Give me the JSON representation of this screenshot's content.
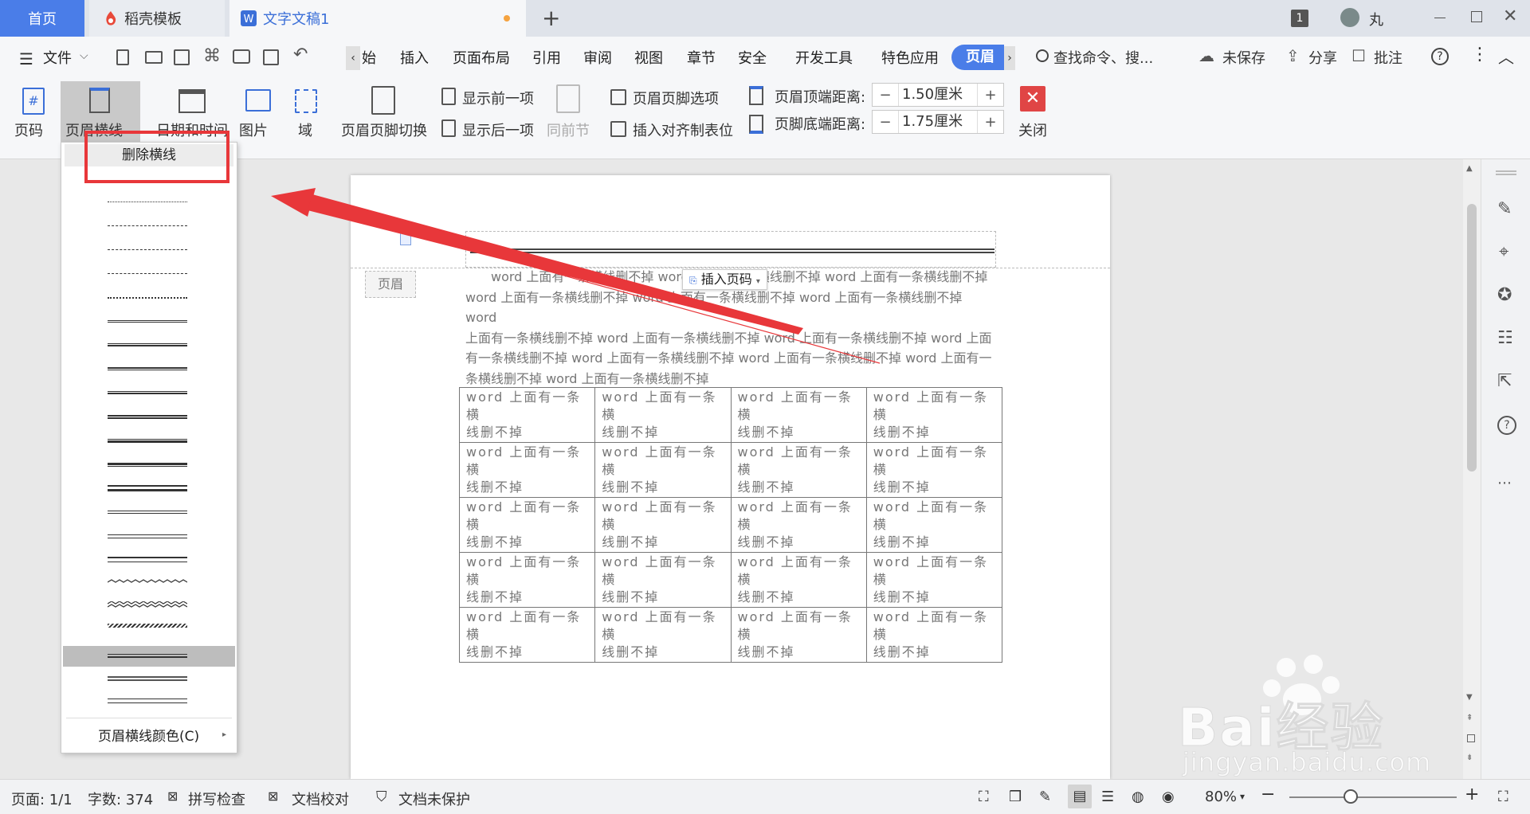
{
  "tabs": {
    "home": "首页",
    "template": "稻壳模板",
    "doc": "文字文稿1",
    "badge": "1",
    "user": "丸"
  },
  "menu": {
    "file": "文件",
    "items": [
      "始",
      "插入",
      "页面布局",
      "引用",
      "审阅",
      "视图",
      "章节",
      "安全",
      "开发工具",
      "特色应用"
    ],
    "active": "页眉",
    "search": "查找命令、搜...",
    "unsaved": "未保存",
    "share": "分享",
    "comment": "批注"
  },
  "ribbon": {
    "page_number": "页码",
    "header_line": "页眉横线",
    "date_time": "日期和时间",
    "picture": "图片",
    "field": "域",
    "switch": "页眉页脚切换",
    "show_prev": "显示前一项",
    "show_next": "显示后一项",
    "same_prev": "同前节",
    "options": "页眉页脚选项",
    "align_tab": "插入对齐制表位",
    "top_dist_label": "页眉顶端距离:",
    "top_dist_value": "1.50厘米",
    "bottom_dist_label": "页脚底端距离:",
    "bottom_dist_value": "1.75厘米",
    "close": "关闭"
  },
  "dropdown": {
    "delete": "删除横线",
    "color": "页眉横线颜色(C)"
  },
  "document": {
    "header_tag": "页眉",
    "insert_page": "插入页码",
    "body_lines": [
      "word 上面有一条横线删不掉 word 上面有一条横线删不掉 word 上面有一条横线删不掉",
      "word 上面有一条横线删不掉 word 上面有一条横线删不掉 word 上面有一条横线删不掉 word",
      "上面有一条横线删不掉 word 上面有一条横线删不掉 word 上面有一条横线删不掉 word 上面",
      "有一条横线删不掉 word 上面有一条横线删不掉 word 上面有一条横线删不掉 word 上面有一",
      "条横线删不掉 word 上面有一条横线删不掉"
    ],
    "cell_line1": "word 上面有一条横",
    "cell_line2": "线删不掉"
  },
  "status": {
    "page": "页面: 1/1",
    "words": "字数: 374",
    "spell": "拼写检查",
    "proof": "文档校对",
    "protect": "文档未保护",
    "zoom": "80%"
  },
  "watermark": {
    "brand": "Bai经验",
    "url": "jingyan.baidu.com"
  },
  "colors": {
    "accent": "#4a7de8",
    "arrow": "#e8373a",
    "close": "#e04545"
  }
}
